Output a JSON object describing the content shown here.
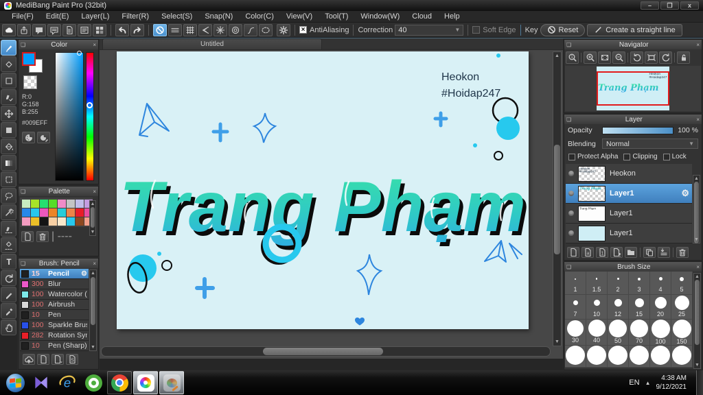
{
  "window": {
    "title": "MediBang Paint Pro (32bit)",
    "minimize": "–",
    "restore": "❐",
    "close": "x"
  },
  "menu": {
    "items": [
      "File(F)",
      "Edit(E)",
      "Layer(L)",
      "Filter(R)",
      "Select(S)",
      "Snap(N)",
      "Color(C)",
      "View(V)",
      "Tool(T)",
      "Window(W)",
      "Cloud",
      "Help"
    ]
  },
  "toolbar": {
    "groups": [
      {
        "id": "file",
        "icons": [
          "cloud",
          "share",
          "chat",
          "comment",
          "document",
          "doc-list",
          "tiles"
        ]
      },
      {
        "id": "history",
        "icons": [
          "undo",
          "redo"
        ]
      },
      {
        "id": "snap",
        "icons": [
          "snap-off",
          "snap-parallel",
          "snap-grid",
          "snap-vanish",
          "snap-radial",
          "snap-concentric",
          "snap-curve",
          "snap-ellipse",
          "gear"
        ],
        "active": "snap-off"
      }
    ],
    "antialiasing_label": "AntiAliasing",
    "correction_label": "Correction",
    "correction_value": "40",
    "soft_edge_label": "Soft Edge",
    "key_label": "Key",
    "reset_label": "Reset",
    "straight_line_label": "Create a straight line"
  },
  "tools": {
    "items": [
      "brush",
      "eraser",
      "rect",
      "dot-pen",
      "move",
      "fill-rect",
      "bucket",
      "gradient",
      "marquee",
      "lasso",
      "wand",
      "select-pen",
      "select-eraser",
      "text",
      "transform",
      "pen",
      "eyedropper",
      "hand"
    ],
    "active": "brush"
  },
  "color_panel": {
    "title": "Color",
    "r": "R:0",
    "g": "G:158",
    "b": "B:255",
    "hex": "#009EFF",
    "fg_color": "#009EFF",
    "buttons": [
      "palette-wheel",
      "palette-edit"
    ]
  },
  "palette_panel": {
    "title": "Palette",
    "colors": [
      "#c8ecc0",
      "#a8e428",
      "#28e070",
      "#58dc28",
      "#f08cc8",
      "#c4c4c4",
      "#c0bce8",
      "#c49ce0",
      "#2888e8",
      "#28c8ec",
      "#ec58bc",
      "#ec8428",
      "#28ccd8",
      "#ec8448",
      "#e81c28",
      "#ec4ca0",
      "#f49cc0",
      "#ecc028",
      "#141414",
      "#f8d0a4",
      "#f8e8cc",
      "#28c8ec",
      "#8c4820",
      "#f4a08c"
    ],
    "footer_icons": [
      "page-new",
      "trash"
    ],
    "divider": "|  ----"
  },
  "brush_panel": {
    "title": "Brush: Pencil",
    "brushes": [
      {
        "color": "#202020",
        "size": "15",
        "name": "Pencil",
        "selected": true
      },
      {
        "color": "#ec58c8",
        "size": "300",
        "name": "Blur"
      },
      {
        "color": "#7ce8e8",
        "size": "100",
        "name": "Watercolor (W"
      },
      {
        "color": "#d8d8d8",
        "size": "100",
        "name": "Airbrush"
      },
      {
        "color": "#202020",
        "size": "10",
        "name": "Pen"
      },
      {
        "color": "#2850e8",
        "size": "100",
        "name": "Sparkle Brush"
      },
      {
        "color": "#e82028",
        "size": "282",
        "name": "Rotation Sym"
      },
      {
        "color": "#202020",
        "size": "10",
        "name": "Pen (Sharp)"
      }
    ],
    "footer_icons": [
      "cloud-up",
      "page-new",
      "page-arrow",
      "page-s"
    ]
  },
  "canvas": {
    "tab": "Untitled",
    "background": "#d9f1f6",
    "credit_line1": "Heokon",
    "credit_line2": "#Hoidap247",
    "lettering": "Trang Phạm",
    "gradient_top": "#3be89e",
    "gradient_bottom": "#2f9ff2",
    "doodle_blue": "#2e86de",
    "doodle_cyan": "#27c9ee"
  },
  "navigator": {
    "title": "Navigator",
    "buttons": [
      "zoom-actual",
      "|",
      "zoom-in",
      "zoom-fit",
      "zoom-out",
      "|",
      "rotate-left",
      "view-reset",
      "rotate-right",
      "|",
      "lock"
    ]
  },
  "layer_panel": {
    "title": "Layer",
    "opacity_label": "Opacity",
    "opacity_value": "100 %",
    "blending_label": "Blending",
    "blending_value": "Normal",
    "checkboxes": [
      "Protect Alpha",
      "Clipping",
      "Lock"
    ],
    "layers": [
      {
        "name": "Heokon",
        "thumb": "credit",
        "selected": false
      },
      {
        "name": "Layer1",
        "thumb": "teal-text",
        "selected": true
      },
      {
        "name": "Layer1",
        "thumb": "small-text",
        "selected": false
      },
      {
        "name": "Layer1",
        "thumb": "solid-blue",
        "selected": false
      }
    ],
    "footer_icons": [
      "page-new",
      "page-a",
      "page-1",
      "page-add",
      "folder",
      "|",
      "duplicate",
      "merge",
      "|",
      "trash"
    ]
  },
  "brush_size_panel": {
    "title": "Brush Size",
    "rows": [
      [
        {
          "label": "1",
          "dot": 2
        },
        {
          "label": "1.5",
          "dot": 2.5
        },
        {
          "label": "2",
          "dot": 3
        },
        {
          "label": "3",
          "dot": 4
        },
        {
          "label": "4",
          "dot": 5
        },
        {
          "label": "5",
          "dot": 6
        }
      ],
      [
        {
          "label": "7",
          "dot": 7
        },
        {
          "label": "10",
          "dot": 9
        },
        {
          "label": "12",
          "dot": 11
        },
        {
          "label": "15",
          "dot": 13
        },
        {
          "label": "20",
          "dot": 17
        },
        {
          "label": "25",
          "dot": 21
        }
      ],
      [
        {
          "label": "30",
          "dot": 24
        },
        {
          "label": "40",
          "dot": 25
        },
        {
          "label": "50",
          "dot": 26
        },
        {
          "label": "70",
          "dot": 26
        },
        {
          "label": "100",
          "dot": 27
        },
        {
          "label": "150",
          "dot": 27
        }
      ],
      [
        {
          "label": "",
          "dot": 28
        },
        {
          "label": "",
          "dot": 28
        },
        {
          "label": "",
          "dot": 28
        },
        {
          "label": "",
          "dot": 28
        },
        {
          "label": "",
          "dot": 28
        },
        {
          "label": "",
          "dot": 28
        }
      ]
    ]
  },
  "taskbar": {
    "apps": [
      {
        "icon": "windows-start",
        "highlighted": false
      },
      {
        "icon": "kmplayer",
        "highlighted": false
      },
      {
        "icon": "internet-explorer",
        "highlighted": false
      },
      {
        "icon": "coccoc",
        "highlighted": false
      },
      {
        "icon": "chrome",
        "highlighted": false,
        "framed": true
      },
      {
        "icon": "medibang",
        "highlighted": true
      },
      {
        "icon": "paint-app",
        "highlighted": true
      }
    ],
    "tray": {
      "lang": "EN",
      "expand": "▲",
      "time": "4:38 AM",
      "date": "9/12/2021"
    }
  }
}
